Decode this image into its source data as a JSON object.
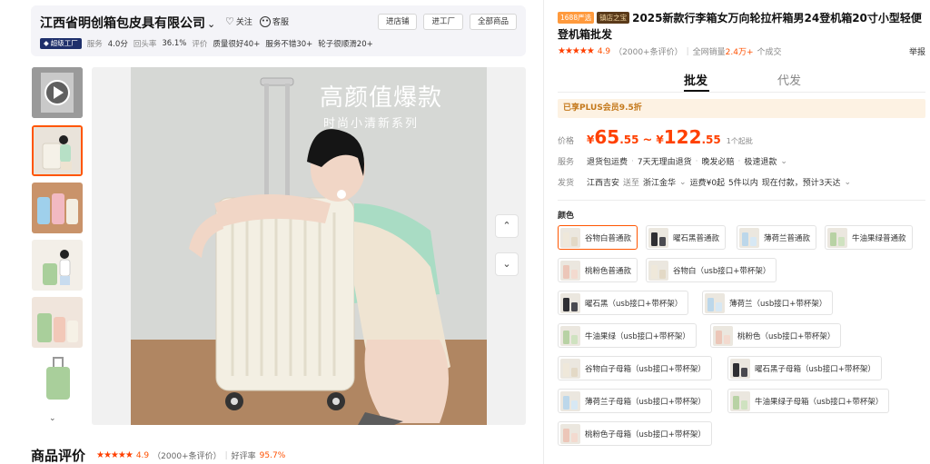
{
  "shop": {
    "name": "江西省明创箱包皮具有限公司",
    "follow_label": "关注",
    "service_label": "客服",
    "buttons": [
      "进店铺",
      "进工厂",
      "全部商品"
    ],
    "factory_badge": "超级工厂",
    "stats": {
      "service_label": "服务",
      "service_value": "4.0分",
      "repurchase_label": "回头率",
      "repurchase_value": "36.1%",
      "eval_label": "评价",
      "tags": [
        "质量很好40+",
        "服务不错30+",
        "轮子很顺滑20+"
      ]
    }
  },
  "gallery": {
    "banner_title": "高颜值爆款",
    "banner_subtitle": "时尚小清新系列",
    "thumb_count": 6,
    "selected_thumb": 1
  },
  "reviews": {
    "title": "商品评价",
    "rating": "4.9",
    "count": "（2000+条评价）",
    "positive_label": "好评率",
    "positive_rate": "95.7%"
  },
  "product": {
    "tag1": "1688严选",
    "tag2": "镇店之宝",
    "title": "2025新款行李箱女万向轮拉杆箱男24登机箱20寸小型轻便登机箱批发",
    "rating": "4.9",
    "rating_count": "（2000+条评价）",
    "sales_label": "全网销量",
    "sales_value": "2.4万+",
    "sales_suffix": "个成交",
    "right_label": "举报"
  },
  "tabs": [
    "批发",
    "代发"
  ],
  "plus_text": "已享PLUS会员9.5折",
  "price": {
    "label": "价格",
    "currency": "¥",
    "low_int": "65",
    "low_dec": ".55",
    "sep": "~",
    "high_int": "122",
    "high_dec": ".55",
    "moq": "1个起批"
  },
  "service_row": {
    "label": "服务",
    "items": [
      "退货包运费",
      "7天无理由退货",
      "晚发必赔",
      "极速退款"
    ]
  },
  "ship_row": {
    "label": "发货",
    "origin": "江西吉安",
    "to_label": "送至",
    "destination": "浙江金华",
    "freight": "运费¥0起",
    "qty": "5件以内",
    "lead": "现在付款，预计3天达"
  },
  "color_label": "颜色",
  "skus": [
    {
      "label": "谷物白普通款",
      "c1": "#efe8da",
      "c2": "#e3d9c6"
    },
    {
      "label": "曜石黑普通款",
      "c1": "#2f2f33",
      "c2": "#4a4a50"
    },
    {
      "label": "薄荷兰普通款",
      "c1": "#bcd7ea",
      "c2": "#d7e8f4"
    },
    {
      "label": "牛油果绿普通款",
      "c1": "#b8d2a4",
      "c2": "#cfe2c0"
    },
    {
      "label": "桃粉色普通款",
      "c1": "#ecc6b8",
      "c2": "#f3dacf"
    },
    {
      "label": "谷物白（usb接口+带杯架）",
      "c1": "#efe8da",
      "c2": "#e3d9c6"
    },
    {
      "label": "曜石黑（usb接口+带杯架）",
      "c1": "#2f2f33",
      "c2": "#4a4a50"
    },
    {
      "label": "薄荷兰（usb接口+带杯架）",
      "c1": "#bcd7ea",
      "c2": "#d7e8f4"
    },
    {
      "label": "牛油果绿（usb接口+带杯架）",
      "c1": "#b8d2a4",
      "c2": "#cfe2c0"
    },
    {
      "label": "桃粉色（usb接口+带杯架）",
      "c1": "#ecc6b8",
      "c2": "#f3dacf"
    },
    {
      "label": "谷物白子母箱（usb接口+带杯架）",
      "c1": "#efe8da",
      "c2": "#e3d9c6"
    },
    {
      "label": "曜石黑子母箱（usb接口+带杯架）",
      "c1": "#2f2f33",
      "c2": "#4a4a50"
    },
    {
      "label": "薄荷兰子母箱（usb接口+带杯架）",
      "c1": "#bcd7ea",
      "c2": "#d7e8f4"
    },
    {
      "label": "牛油果绿子母箱（usb接口+带杯架）",
      "c1": "#b8d2a4",
      "c2": "#cfe2c0"
    },
    {
      "label": "桃粉色子母箱（usb接口+带杯架）",
      "c1": "#ecc6b8",
      "c2": "#f3dacf"
    }
  ],
  "selected_sku": 0,
  "colors": {
    "accent": "#ff5000",
    "price": "#ff4000"
  }
}
